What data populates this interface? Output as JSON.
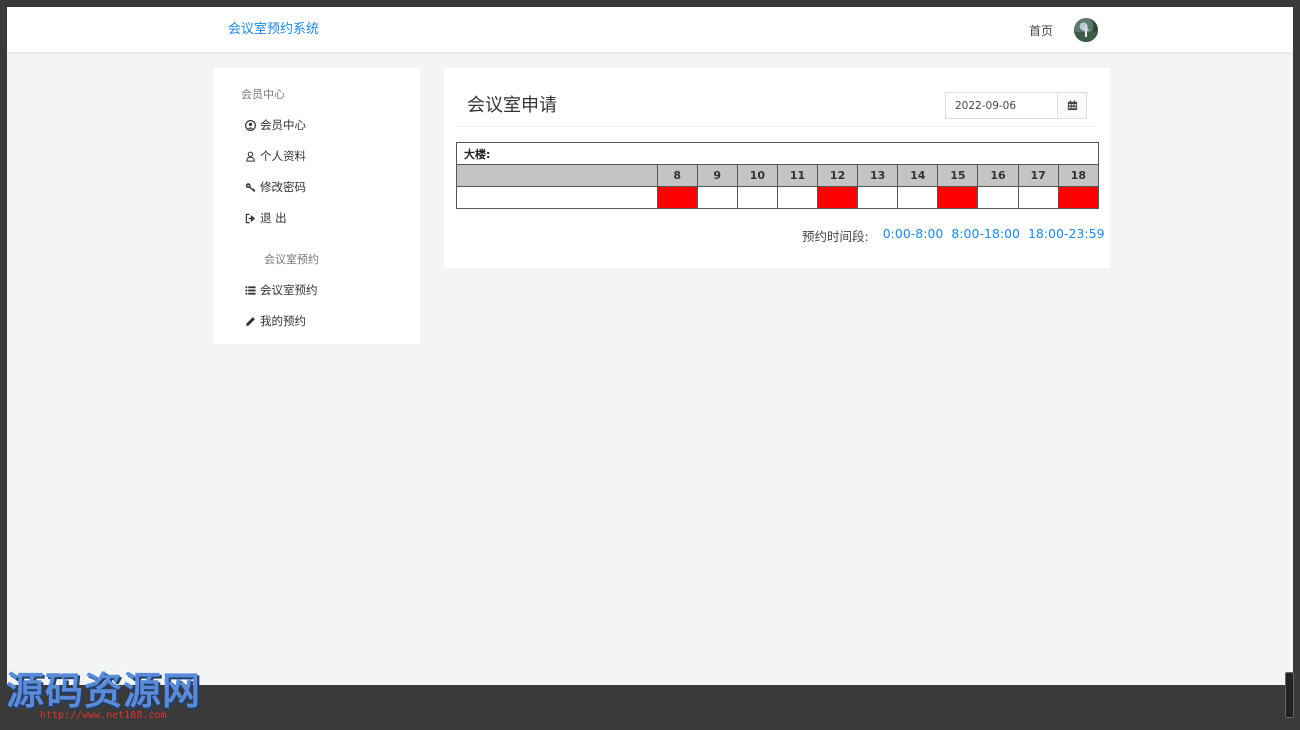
{
  "header": {
    "brand": "会议室预约系统",
    "home": "首页"
  },
  "sidebar": {
    "section1_title": "会员中心",
    "section1_items": [
      {
        "label": "会员中心",
        "icon": "user-circle-icon"
      },
      {
        "label": "个人资料",
        "icon": "user-icon"
      },
      {
        "label": "修改密码",
        "icon": "key-icon"
      },
      {
        "label": "退 出",
        "icon": "sign-out-icon"
      }
    ],
    "section2_title": "会议室预约",
    "section2_items": [
      {
        "label": "会议室预约",
        "icon": "list-icon"
      },
      {
        "label": "我的预约",
        "icon": "pencil-icon"
      }
    ]
  },
  "main": {
    "title": "会议室申请",
    "date_value": "2022-09-06",
    "building_label": "大楼:",
    "hours": [
      "8",
      "9",
      "10",
      "11",
      "12",
      "13",
      "14",
      "15",
      "16",
      "17",
      "18"
    ],
    "booked": [
      true,
      false,
      false,
      false,
      true,
      false,
      false,
      true,
      false,
      false,
      true
    ],
    "legend_label": "预约时间段:",
    "legend_links": [
      "0:00-8:00",
      "8:00-18:00",
      "18:00-23:59"
    ]
  },
  "watermark": {
    "text": "源码资源网",
    "url": "http://www.net188.com"
  },
  "colors": {
    "accent": "#1e88e5",
    "booked": "#ff0000",
    "header_bg": "#c4c4c4",
    "page_bg": "#f3f4f6"
  }
}
